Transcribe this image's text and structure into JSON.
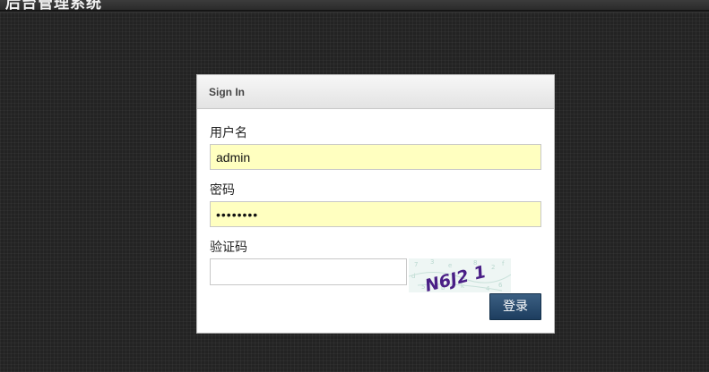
{
  "header": {
    "title": "后台管理系统"
  },
  "login_panel": {
    "title": "Sign In",
    "username_label": "用户名",
    "username_value": "admin",
    "password_label": "密码",
    "password_value": "••••••••",
    "captcha_label": "验证码",
    "captcha_value": "",
    "captcha_text": "N6J2 1",
    "submit_label": "登录"
  },
  "colors": {
    "page_background": "#232323",
    "autofill_yellow": "#ffffc0",
    "button_blue": "#2a4c6f",
    "captcha_purple": "#4a1f86"
  }
}
